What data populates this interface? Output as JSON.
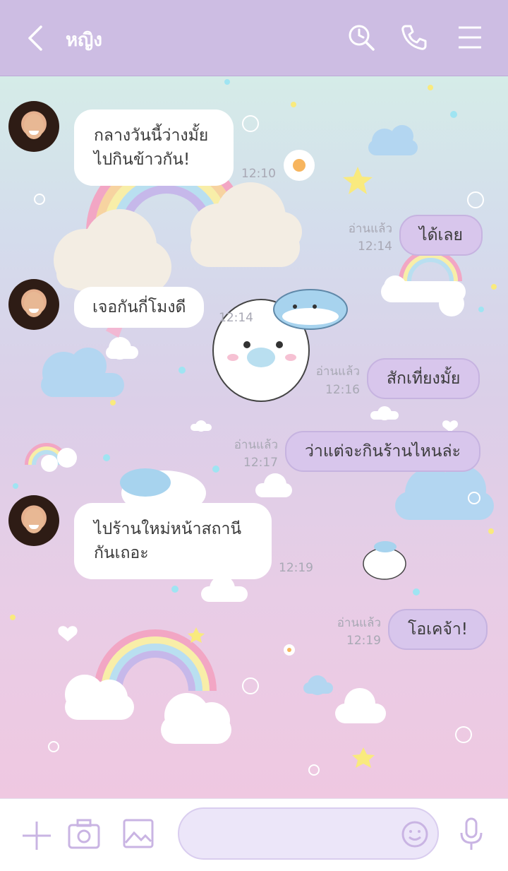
{
  "header": {
    "contact_name": "หญิง",
    "icons": [
      "back-icon",
      "search-history-icon",
      "phone-icon",
      "menu-icon"
    ]
  },
  "messages": [
    {
      "direction": "in",
      "lines": [
        "กลางวันนี้ว่างมั้ย",
        "ไปกินข้าวกัน!"
      ],
      "time": "12:10"
    },
    {
      "direction": "out",
      "text": "ได้เลย",
      "read": "อ่านแล้ว",
      "time": "12:14"
    },
    {
      "direction": "in",
      "lines": [
        "เจอกันกี่โมงดี"
      ],
      "time": "12:14"
    },
    {
      "direction": "out",
      "text": "สักเที่ยงมั้ย",
      "read": "อ่านแล้ว",
      "time": "12:16"
    },
    {
      "direction": "out",
      "text": "ว่าแต่จะกินร้านไหนล่ะ",
      "read": "อ่านแล้ว",
      "time": "12:17"
    },
    {
      "direction": "in",
      "lines": [
        "ไปร้านใหม่หน้าสถานี",
        "กันเถอะ"
      ],
      "time": "12:19"
    },
    {
      "direction": "out",
      "text": "โอเคจ้า!",
      "read": "อ่านแล้ว",
      "time": "12:19"
    }
  ],
  "footer": {
    "input_value": "",
    "icons": [
      "plus-icon",
      "camera-icon",
      "image-icon",
      "emoji-icon",
      "mic-icon"
    ]
  },
  "colors": {
    "header": "#cdbde3",
    "outgoing_bubble": "#d8c6ec",
    "incoming_bubble": "#ffffff",
    "accent_icon": "#c9b4e3"
  }
}
